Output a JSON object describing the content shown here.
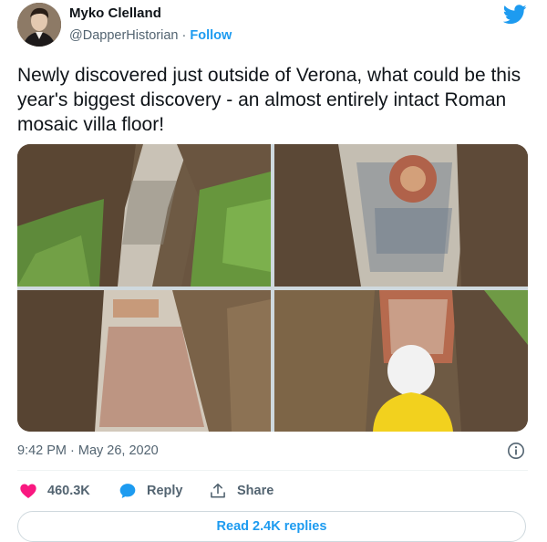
{
  "author": {
    "name": "Myko Clelland",
    "handle": "@DapperHistorian",
    "separator": " · ",
    "follow_label": "Follow"
  },
  "tweet": {
    "text": "Newly discovered just outside of Verona, what could be this year's biggest discovery - an almost entirely intact Roman mosaic villa floor!",
    "timestamp": "9:42 PM · May 26, 2020"
  },
  "actions": {
    "likes": "460.3K",
    "reply_label": "Reply",
    "share_label": "Share"
  },
  "read_replies_label": "Read 2.4K replies",
  "colors": {
    "accent": "#1d9bf0",
    "like": "#f91880",
    "secondary_text": "#536471"
  },
  "icons": [
    "twitter-bird-icon",
    "info-icon",
    "heart-icon",
    "reply-bubble-icon",
    "share-icon"
  ]
}
